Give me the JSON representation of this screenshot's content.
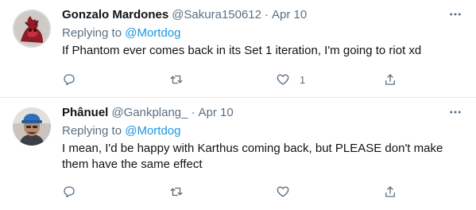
{
  "tweets": [
    {
      "name": "Gonzalo Mardones",
      "handle": "@Sakura150612",
      "dot": "·",
      "date": "Apr 10",
      "replying_prefix": "Replying to",
      "replying_to": "@Mortdog",
      "text": "If Phantom ever comes back in its Set 1 iteration, I'm going to riot xd",
      "like_count": "1",
      "avatar_icon": "red-character-avatar"
    },
    {
      "name": "Phânuel",
      "handle": "@Gankplang_",
      "dot": "·",
      "date": "Apr 10",
      "replying_prefix": "Replying to",
      "replying_to": "@Mortdog",
      "text": "I mean, I'd be happy with Karthus coming back, but PLEASE don't make them have the same effect",
      "like_count": "",
      "avatar_icon": "person-blue-cap-avatar"
    }
  ],
  "icons": {
    "more": "more-horizontal-icon",
    "reply": "reply-icon",
    "retweet": "retweet-icon",
    "like": "heart-icon",
    "share": "share-icon"
  },
  "colors": {
    "text": "#0f1419",
    "secondary": "#5b7083",
    "link": "#1b95e0",
    "divider": "#e3e8eb"
  }
}
